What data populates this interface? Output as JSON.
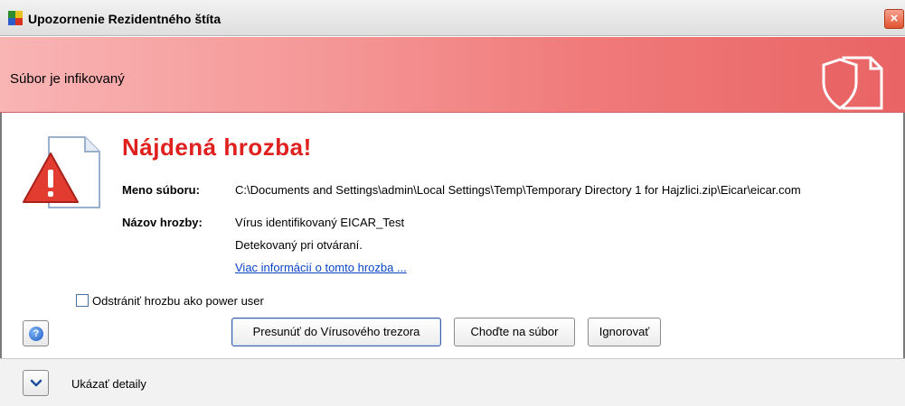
{
  "window": {
    "title": "Upozornenie Rezidentného štíta",
    "close_label": "×",
    "app_icon": "avg-app-icon"
  },
  "banner": {
    "text": "Súbor je infikovaný",
    "icon": "shield-document-icon"
  },
  "alert": {
    "heading": "Nájdená hrozba!",
    "icon": "warning-document-icon",
    "file_label": "Meno súboru:",
    "file_value": "C:\\Documents and Settings\\admin\\Local Settings\\Temp\\Temporary Directory 1 for Hajzlici.zip\\Eicar\\eicar.com",
    "threat_label": "Názov hrozby:",
    "threat_value": "Vírus identifikovaný EICAR_Test",
    "detected_text": "Detekovaný pri otváraní.",
    "more_link": "Viac informácií o tomto hrozba ..."
  },
  "options": {
    "power_user_label": "Odstrániť hrozbu ako power user",
    "power_user_checked": false
  },
  "buttons": {
    "help": "?",
    "move": "Presunúť do Vírusového trezora",
    "goto": "Choďte na súbor",
    "ignore": "Ignorovať"
  },
  "footer": {
    "details_label": "Ukázať detaily"
  },
  "colors": {
    "heading": "#e0201f",
    "link": "#0a46c8",
    "banner": "#f07a7a"
  }
}
